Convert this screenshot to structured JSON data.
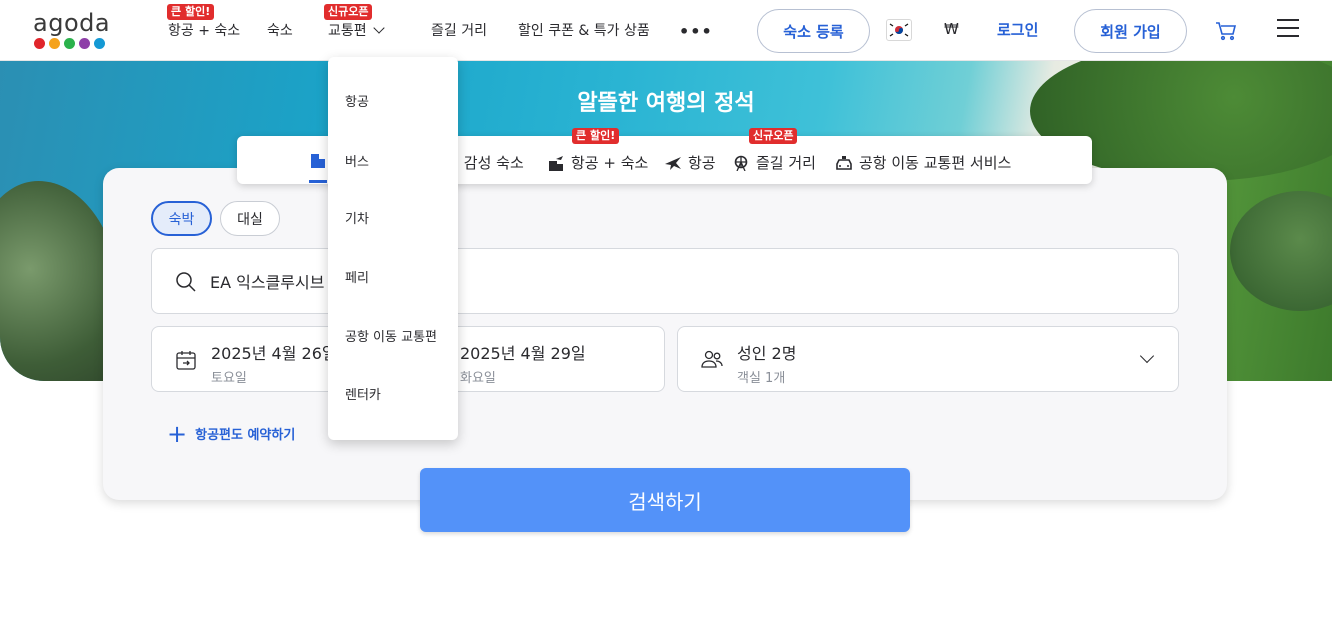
{
  "header": {
    "logo": {
      "text": "agoda",
      "dot_colors": [
        "#e0252b",
        "#f5a21b",
        "#2bb24c",
        "#8e3fa8",
        "#1499d4"
      ]
    },
    "nav": [
      {
        "label": "항공 + 숙소",
        "badge": "큰 할인!"
      },
      {
        "label": "숙소"
      },
      {
        "label": "교통편",
        "badge": "신규오픈"
      },
      {
        "label": "즐길 거리"
      },
      {
        "label": "할인 쿠폰 & 특가 상품"
      }
    ],
    "more_label": "•••",
    "register_property": "숙소 등록",
    "currency": "₩",
    "login": "로그인",
    "signup": "회원 가입",
    "icons": {
      "cart": "cart-icon",
      "menu": "hamburger-menu-icon",
      "flag": "korea-flag-icon"
    }
  },
  "hero": {
    "title": "알뜰한 여행의 정석"
  },
  "category_tabs": [
    {
      "label": "! 감성 숙소",
      "icon": "hotel-icon"
    },
    {
      "label": "항공 + 숙소",
      "icon": "flight-hotel-icon",
      "badge": "큰 할인!"
    },
    {
      "label": "항공",
      "icon": "airplane-icon"
    },
    {
      "label": "즐길 거리",
      "icon": "ferris-wheel-icon",
      "badge": "신규오픈"
    },
    {
      "label": "공항 이동 교통편 서비스",
      "icon": "taxi-icon"
    }
  ],
  "search": {
    "stay_types": [
      "숙박",
      "대실"
    ],
    "destination_value": "EA 익스클루시브",
    "checkin": {
      "date": "2025년 4월 26일",
      "day": "토요일"
    },
    "checkout": {
      "date": "2025년 4월 29일",
      "day": "화요일"
    },
    "guests": {
      "main": "성인 2명",
      "sub": "객실 1개"
    },
    "add_flight": "항공편도 예약하기",
    "submit": "검색하기"
  },
  "transport_dropdown": {
    "items": [
      "항공",
      "버스",
      "기차",
      "페리",
      "공항 이동 교통편",
      "렌터카"
    ]
  },
  "colors": {
    "brand_blue": "#2761d6",
    "search_button": "#5392f9",
    "badge_red": "#e12d2d"
  }
}
